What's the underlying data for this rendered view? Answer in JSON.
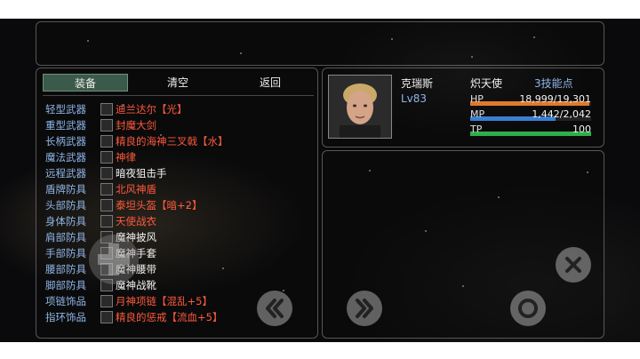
{
  "tabs": {
    "equip": "装备",
    "clear": "清空",
    "back": "返回"
  },
  "equipment": [
    {
      "slot": "轻型武器",
      "item": "迪兰达尔【光】",
      "color": "#ff5a3c"
    },
    {
      "slot": "重型武器",
      "item": "封魔大剑",
      "color": "#ff5a3c"
    },
    {
      "slot": "长柄武器",
      "item": "精良的海神三叉戟【水】",
      "color": "#ff5a3c"
    },
    {
      "slot": "魔法武器",
      "item": "神律",
      "color": "#ff5a3c"
    },
    {
      "slot": "远程武器",
      "item": "暗夜狙击手",
      "color": "#f2f2f2"
    },
    {
      "slot": "盾牌防具",
      "item": "北风神盾",
      "color": "#ff5a3c"
    },
    {
      "slot": "头部防具",
      "item": "泰坦头盔【暗+2】",
      "color": "#ff5a3c"
    },
    {
      "slot": "身体防具",
      "item": "天使战衣",
      "color": "#ff5a3c"
    },
    {
      "slot": "肩部防具",
      "item": "魔神披风",
      "color": "#f2f2f2"
    },
    {
      "slot": "手部防具",
      "item": "魔神手套",
      "color": "#f2f2f2"
    },
    {
      "slot": "腰部防具",
      "item": "魔神腰带",
      "color": "#f2f2f2"
    },
    {
      "slot": "脚部防具",
      "item": "魔神战靴",
      "color": "#f2f2f2"
    },
    {
      "slot": "项链饰品",
      "item": "月神项链【混乱+5】",
      "color": "#ff5a3c"
    },
    {
      "slot": "指环饰品",
      "item": "精良的惩戒【流血+5】",
      "color": "#ff5a3c"
    }
  ],
  "character": {
    "name": "克瑞斯",
    "level": "Lv83",
    "class": "炽天使",
    "skill_points": "3技能点",
    "hp": {
      "label": "HP",
      "value": "18,999/19,301",
      "fraction": 0.984,
      "color": "#e07a2a"
    },
    "mp": {
      "label": "MP",
      "value": "1,442/2,042",
      "fraction": 0.706,
      "color": "#3a7fd0"
    },
    "tp": {
      "label": "TP",
      "value": "100",
      "fraction": 1.0,
      "color": "#2fae4a"
    }
  },
  "icons": {
    "rewind": "double-chevron-left-icon",
    "forward": "double-chevron-right-icon",
    "confirm": "circle-icon",
    "close": "x-icon",
    "dpad": "dpad-icon"
  }
}
